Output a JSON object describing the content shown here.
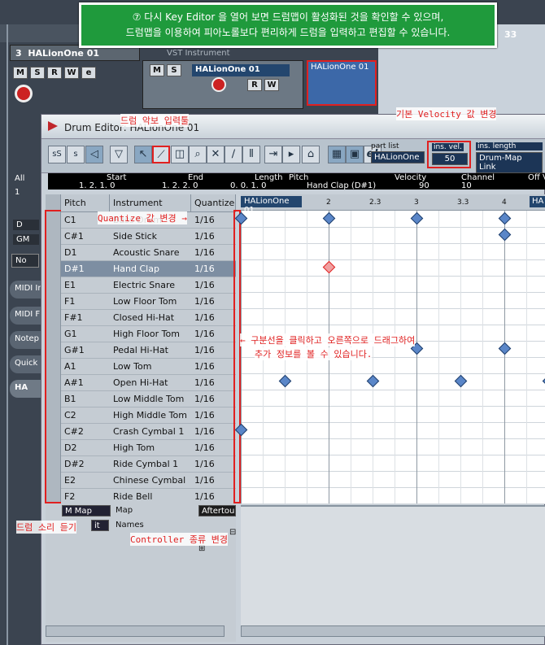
{
  "callout": {
    "line1": "⑦ 다시 Key Editor 을 열어 보면 드럼맵이 활성화된 것을 확인할 수 있으며,",
    "line2": "드럼맵을 이용하여 피아노롤보다 편리하게 드럼을 입력하고 편집할 수 있습니다."
  },
  "bg": {
    "track_num": "3",
    "track_name": "HALionOne 01",
    "vst_label": "VST Instrument",
    "track2_name": "HALionOne 01",
    "part_name": "HALionOne 01",
    "ruler_mark": "33",
    "side_all": "All",
    "side_one": "1",
    "side_d": "D",
    "side_gm": "GM",
    "side_no": "No",
    "ins_items": [
      "MIDI In",
      "MIDI F",
      "Notep",
      "Quick",
      "HA"
    ]
  },
  "editor": {
    "title": "Drum Editor: HALionOne 01",
    "part_list_label": "part list",
    "part_list_value": "HALionOne",
    "ins_vel_label": "ins. vel.",
    "ins_vel_value": "50",
    "ins_len_label": "ins. length",
    "ins_len_value": "Drum-Map Link",
    "info": {
      "start_label": "Start",
      "start_value": "1. 2. 1.   0",
      "end_label": "End",
      "end_value": "1. 2. 2.   0",
      "length_label": "Length",
      "length_value": "0. 0. 1.   0",
      "pitch_label": "Pitch",
      "pitch_value": "Hand Clap (D#1)",
      "velocity_label": "Velocity",
      "velocity_value": "90",
      "channel_label": "Channel",
      "channel_value": "10",
      "offvel_label": "Off V"
    },
    "cols": {
      "pitch": "Pitch",
      "instrument": "Instrument",
      "quantize": "Quantize"
    },
    "rows": [
      {
        "pitch": "C1",
        "inst": "Bass Drum",
        "q": "1/16"
      },
      {
        "pitch": "C#1",
        "inst": "Side Stick",
        "q": "1/16"
      },
      {
        "pitch": "D1",
        "inst": "Acoustic Snare",
        "q": "1/16"
      },
      {
        "pitch": "D#1",
        "inst": "Hand Clap",
        "q": "1/16"
      },
      {
        "pitch": "E1",
        "inst": "Electric Snare",
        "q": "1/16"
      },
      {
        "pitch": "F1",
        "inst": "Low Floor Tom",
        "q": "1/16"
      },
      {
        "pitch": "F#1",
        "inst": "Closed Hi-Hat",
        "q": "1/16"
      },
      {
        "pitch": "G1",
        "inst": "High Floor Tom",
        "q": "1/16"
      },
      {
        "pitch": "G#1",
        "inst": "Pedal Hi-Hat",
        "q": "1/16"
      },
      {
        "pitch": "A1",
        "inst": "Low Tom",
        "q": "1/16"
      },
      {
        "pitch": "A#1",
        "inst": "Open Hi-Hat",
        "q": "1/16"
      },
      {
        "pitch": "B1",
        "inst": "Low Middle Tom",
        "q": "1/16"
      },
      {
        "pitch": "C2",
        "inst": "High Middle Tom",
        "q": "1/16"
      },
      {
        "pitch": "C#2",
        "inst": "Crash Cymbal 1",
        "q": "1/16"
      },
      {
        "pitch": "D2",
        "inst": "High Tom",
        "q": "1/16"
      },
      {
        "pitch": "D#2",
        "inst": "Ride Cymbal 1",
        "q": "1/16"
      },
      {
        "pitch": "E2",
        "inst": "Chinese Cymbal",
        "q": "1/16"
      },
      {
        "pitch": "F2",
        "inst": "Ride Bell",
        "q": "1/16"
      }
    ],
    "ruler": {
      "part": "HALionOne 01",
      "m2": "2",
      "m23": "2.3",
      "m3": "3",
      "m33": "3.3",
      "m4": "4",
      "part_right": "HA"
    },
    "map_select": "M Map",
    "map_label": "Map",
    "names_select": "it",
    "names_label": "Names",
    "ctrl_select": "Aftertou",
    "ann": {
      "drum_tool": "드럼 악보 입력툴",
      "vel": "기본 Velocity 값 변경",
      "quant": "Quantize 값 변경 →",
      "divider1": "← 구분선을 클릭하고 오른쪽으로 드래그하여",
      "divider2": "추가 정보를 볼 수 있습니다.",
      "drum_listen": "드럼 소리 듣기",
      "ctrl_type": "Controller 종류 변경"
    }
  }
}
